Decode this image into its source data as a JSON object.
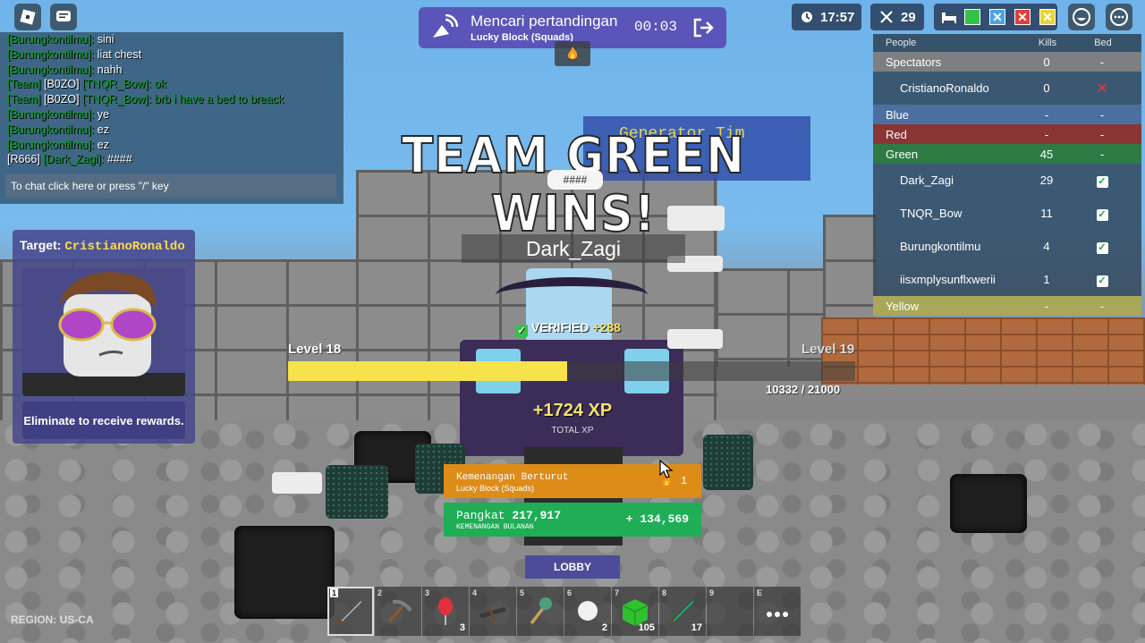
{
  "chat": {
    "lines": [
      {
        "name": "[Burungkontilmu]:",
        "msg": "sini"
      },
      {
        "name": "[Burungkontilmu]:",
        "msg": "liat chest"
      },
      {
        "name": "[Burungkontilmu]:",
        "msg": "nahh"
      },
      {
        "team": "[Team]",
        "tag": "[B0ZO]",
        "name": "[TNQR_Bow]:",
        "msg": "ok"
      },
      {
        "team": "[Team]",
        "tag": "[B0ZO]",
        "name": "[TNQR_Bow]:",
        "msg": "brb i have a bed to breack"
      },
      {
        "name": "[Burungkontilmu]:",
        "msg": "ye"
      },
      {
        "name": "[Burungkontilmu]:",
        "msg": "ez"
      },
      {
        "name": "[Burungkontilmu]:",
        "msg": "ez"
      },
      {
        "tag": "[R666]",
        "name": "[Dark_Zagi]:",
        "msg": "####"
      }
    ],
    "input_placeholder": "To chat click here or press \"/\" key"
  },
  "match": {
    "title": "Mencari pertandingan",
    "mode": "Lucky Block (Squads)",
    "timer": "00:03"
  },
  "topbar": {
    "clock": "17:57",
    "kills": "29"
  },
  "scoreboard": {
    "headers": {
      "people": "People",
      "kills": "Kills",
      "bed": "Bed"
    },
    "rows": [
      {
        "type": "team",
        "name": "Spectators",
        "kills": "0",
        "bed": "-",
        "color": "#7d7f82"
      },
      {
        "type": "player",
        "name": "CristianoRonaldo",
        "kills": "0",
        "bed": "destroyed"
      },
      {
        "type": "team",
        "name": "Blue",
        "kills": "-",
        "bed": "-",
        "color": "#4a6fa0"
      },
      {
        "type": "team",
        "name": "Red",
        "kills": "-",
        "bed": "-",
        "color": "#8a3434"
      },
      {
        "type": "team",
        "name": "Green",
        "kills": "45",
        "bed": "-",
        "color": "#2d7a45"
      },
      {
        "type": "player",
        "name": "Dark_Zagi",
        "kills": "29",
        "bed": "alive"
      },
      {
        "type": "player",
        "name": "TNQR_Bow",
        "kills": "11",
        "bed": "alive"
      },
      {
        "type": "player",
        "name": "Burungkontilmu",
        "kills": "4",
        "bed": "alive"
      },
      {
        "type": "player",
        "name": "iisxmplysunflxwerii",
        "kills": "1",
        "bed": "alive"
      },
      {
        "type": "team",
        "name": "Yellow",
        "kills": "-",
        "bed": "-",
        "color": "#a9a75a"
      }
    ]
  },
  "target": {
    "label": "Target:",
    "name": "CristianoRonaldo",
    "caption": "Eliminate to receive rewards."
  },
  "banner": {
    "win_text": "TEAM GREEN WINS!",
    "generator_text": "Generator Tim"
  },
  "player": {
    "nametag": "Dark_Zagi",
    "bubble": "####",
    "verified": "VERIFIED",
    "verified_bonus": "+288"
  },
  "xp": {
    "level_current": "Level 18",
    "level_next": "Level 19",
    "progress_text": "10332 / 21000",
    "progress_fraction": 0.492,
    "gain": "+1724 XP",
    "gain_label": "TOTAL XP"
  },
  "streak": {
    "title": "Kemenangan Berturut",
    "mode": "Lucky Block (Squads)",
    "value": "1"
  },
  "rank": {
    "title": "Pangkat",
    "value": "217,917",
    "sub": "KEMENANGAN BULANAN",
    "delta": "+ 134,569"
  },
  "lobby_label": "LOBBY",
  "hotbar": [
    {
      "num": "1",
      "icon": "sword-icon",
      "count": "",
      "active": true
    },
    {
      "num": "2",
      "icon": "pickaxe-icon",
      "count": ""
    },
    {
      "num": "3",
      "icon": "balloon-icon",
      "count": "3"
    },
    {
      "num": "4",
      "icon": "crossbow-icon",
      "count": ""
    },
    {
      "num": "5",
      "icon": "hammer-icon",
      "count": ""
    },
    {
      "num": "6",
      "icon": "snowball-icon",
      "count": "2"
    },
    {
      "num": "7",
      "icon": "wool-block-icon",
      "count": "105"
    },
    {
      "num": "8",
      "icon": "emerald-sword-icon",
      "count": "17"
    },
    {
      "num": "9",
      "icon": "",
      "count": ""
    },
    {
      "num": "E",
      "icon": "more-icon",
      "count": ""
    }
  ],
  "region": "REGION: US-CA"
}
